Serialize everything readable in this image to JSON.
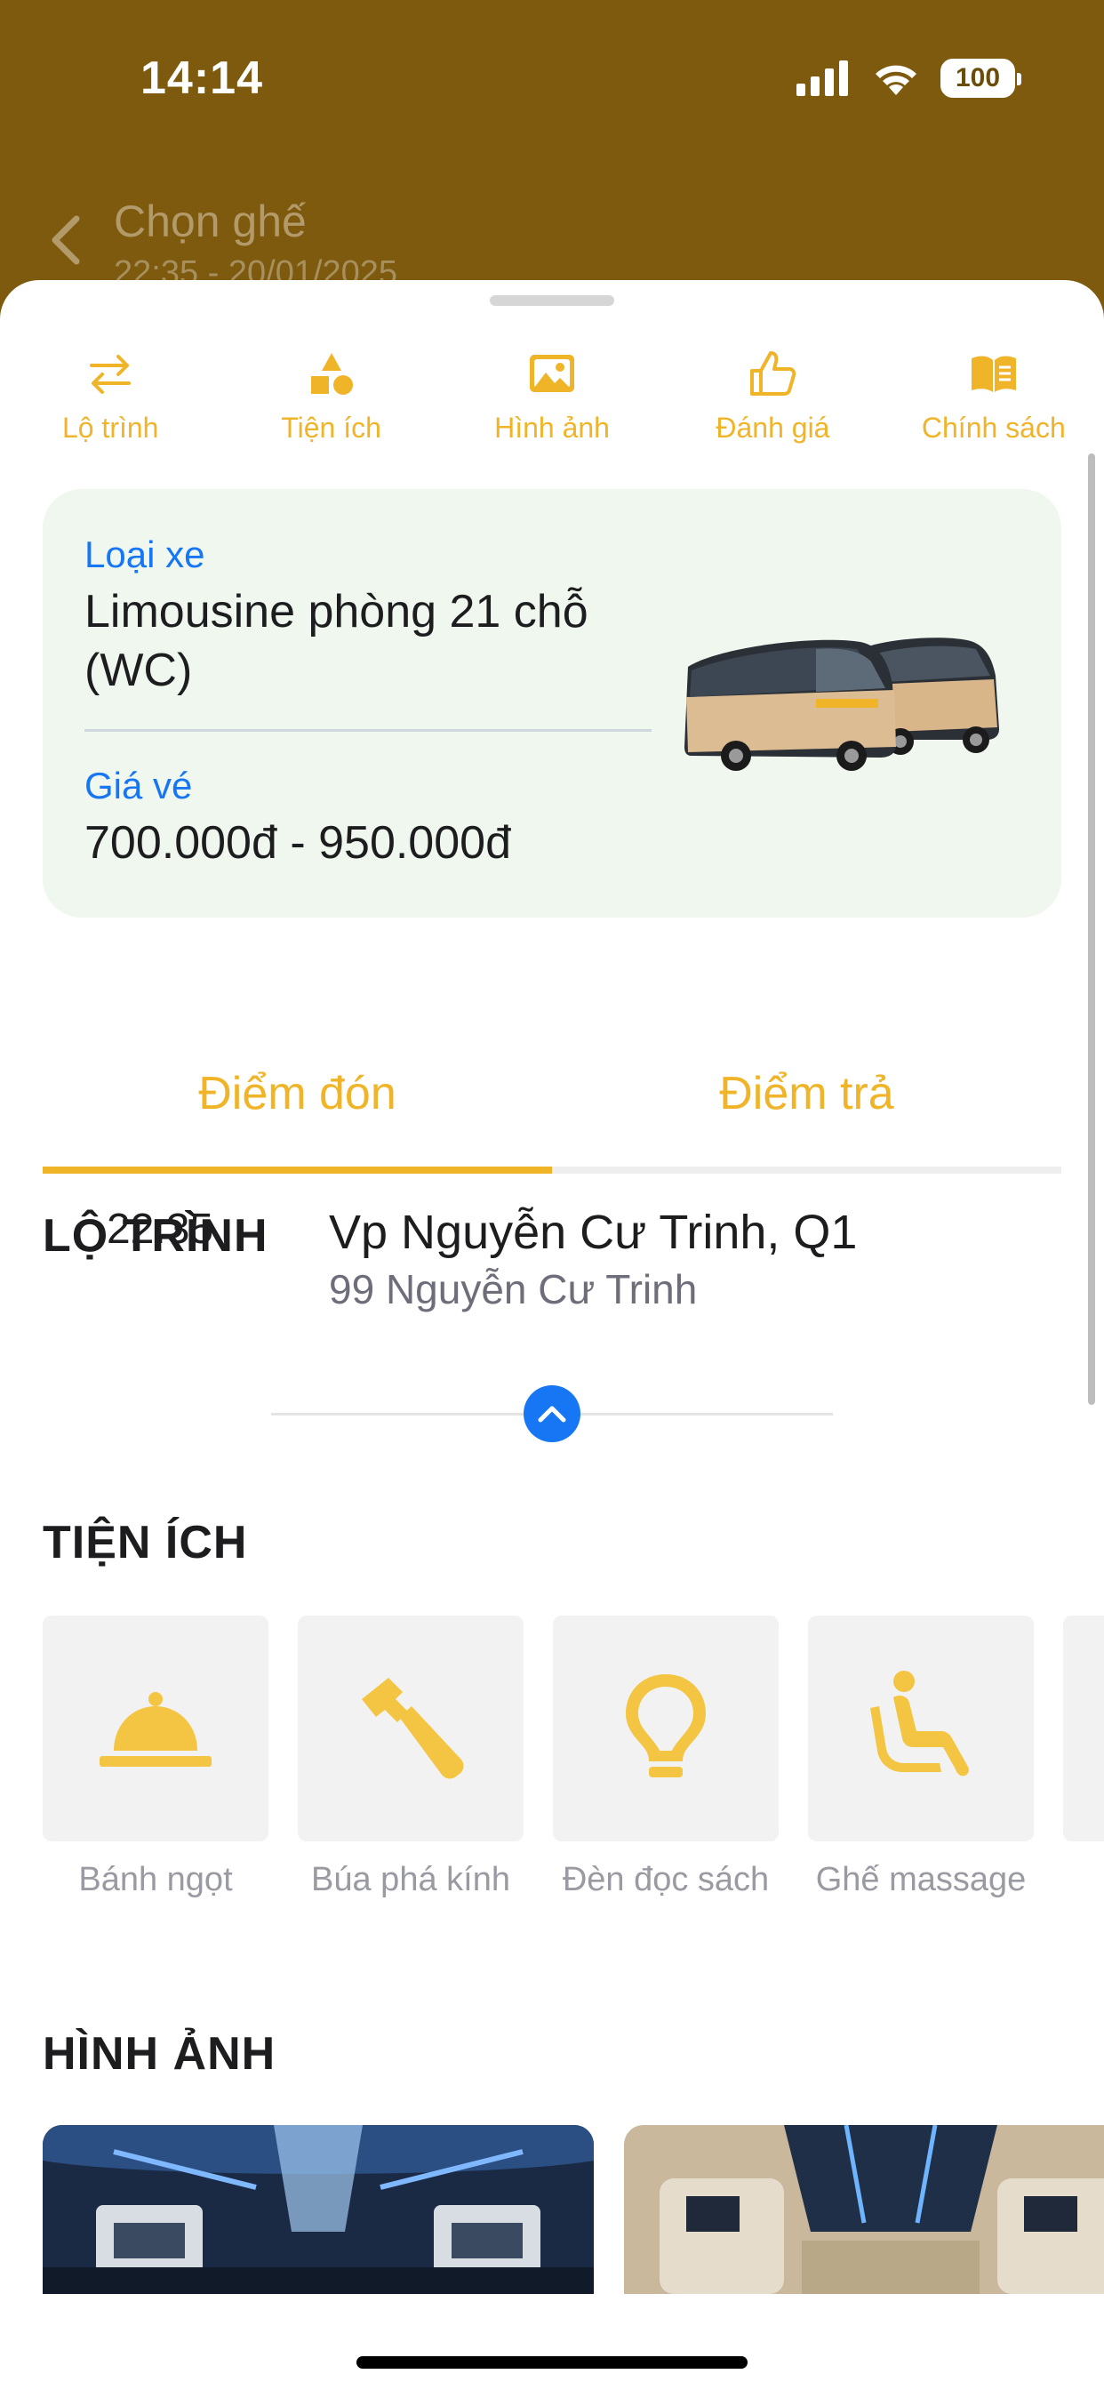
{
  "status_bar": {
    "time": "14:14",
    "battery": "100"
  },
  "header": {
    "title": "Chọn ghế",
    "subtitle": "22:35 - 20/01/2025"
  },
  "tabs": [
    {
      "label": "Lộ trình",
      "icon": "swap-arrows-icon"
    },
    {
      "label": "Tiện ích",
      "icon": "shapes-icon"
    },
    {
      "label": "Hình ảnh",
      "icon": "image-icon"
    },
    {
      "label": "Đánh giá",
      "icon": "thumbs-up-icon"
    },
    {
      "label": "Chính sách",
      "icon": "book-icon"
    }
  ],
  "vehicle": {
    "type_label": "Loại xe",
    "type_line1": "Limousine phòng 21 chỗ",
    "type_line2": "(WC)",
    "price_label": "Giá vé",
    "price_value": "700.000đ - 950.000đ"
  },
  "route": {
    "title": "LỘ TRÌNH",
    "tab_pickup": "Điểm đón",
    "tab_dropoff": "Điểm trả",
    "active_tab": "pickup",
    "stops": [
      {
        "time": "22:35",
        "name": "Vp Nguyễn Cư Trinh, Q1",
        "address": "99 Nguyễn Cư Trinh"
      }
    ]
  },
  "amenities": {
    "title": "TIỆN ÍCH",
    "items": [
      {
        "name": "Bánh ngọt",
        "icon": "food-cloche-icon"
      },
      {
        "name": "Búa phá kính",
        "icon": "hammer-icon"
      },
      {
        "name": "Đèn đọc sách",
        "icon": "lightbulb-icon"
      },
      {
        "name": "Ghế massage",
        "icon": "massage-seat-icon"
      }
    ]
  },
  "photos": {
    "title": "HÌNH ẢNH"
  },
  "colors": {
    "accent": "#f0b429",
    "link_blue": "#1676f3",
    "header_bg": "#7d5a0e",
    "card_bg": "#eff7ee"
  }
}
